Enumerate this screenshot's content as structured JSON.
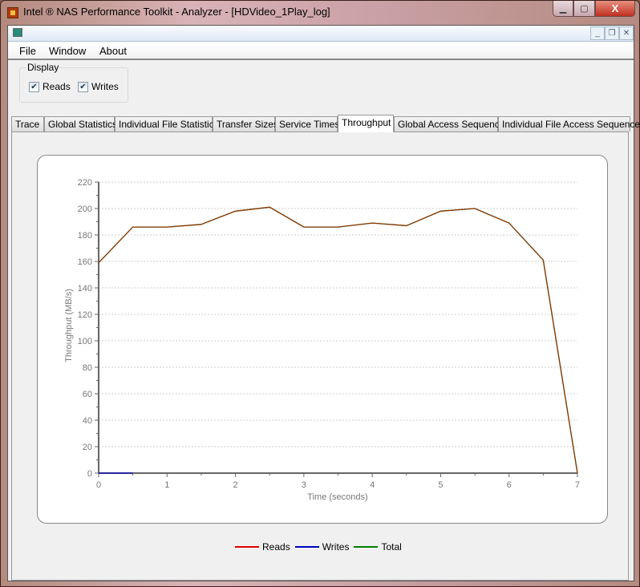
{
  "window": {
    "title": "Intel ® NAS Performance Toolkit - Analyzer - [HDVideo_1Play_log]",
    "close": "X"
  },
  "menu": [
    "File",
    "Window",
    "About"
  ],
  "display": {
    "label": "Display",
    "reads": {
      "label": "Reads",
      "checked": true
    },
    "writes": {
      "label": "Writes",
      "checked": true
    }
  },
  "tabs": [
    {
      "label": "Trace"
    },
    {
      "label": "Global Statistics"
    },
    {
      "label": "Individual File Statistics"
    },
    {
      "label": "Transfer Sizes"
    },
    {
      "label": "Service Times"
    },
    {
      "label": "Throughput",
      "active": true
    },
    {
      "label": "Global Access Sequence"
    },
    {
      "label": "Individual File Access Sequence"
    }
  ],
  "chart_data": {
    "type": "line",
    "title": "",
    "xlabel": "Time (seconds)",
    "ylabel": "Throughput (MB/s)",
    "xlim": [
      0,
      7
    ],
    "ylim": [
      0,
      220
    ],
    "xticks": [
      0,
      1,
      2,
      3,
      4,
      5,
      6,
      7
    ],
    "yticks": [
      0,
      20,
      40,
      60,
      80,
      100,
      120,
      140,
      160,
      180,
      200,
      220
    ],
    "grid": true,
    "legend_position": "bottom",
    "series": [
      {
        "name": "Reads",
        "color": "#e00000",
        "x": [
          0,
          0.5,
          1,
          1.5,
          2,
          2.5,
          3,
          3.5,
          4,
          4.5,
          5,
          5.5,
          6,
          6.5,
          7
        ],
        "values": [
          159,
          186,
          186,
          188,
          198,
          201,
          186,
          186,
          189,
          187,
          198,
          200,
          189,
          161,
          0
        ]
      },
      {
        "name": "Writes",
        "color": "#0000c0",
        "x": [
          0,
          0.5
        ],
        "values": [
          0,
          0
        ]
      },
      {
        "name": "Total",
        "color": "#008000",
        "x": [
          0,
          0.5,
          1,
          1.5,
          2,
          2.5,
          3,
          3.5,
          4,
          4.5,
          5,
          5.5,
          6,
          6.5,
          7
        ],
        "values": [
          159,
          186,
          186,
          188,
          198,
          201,
          186,
          186,
          189,
          187,
          198,
          200,
          189,
          161,
          0
        ]
      }
    ]
  }
}
